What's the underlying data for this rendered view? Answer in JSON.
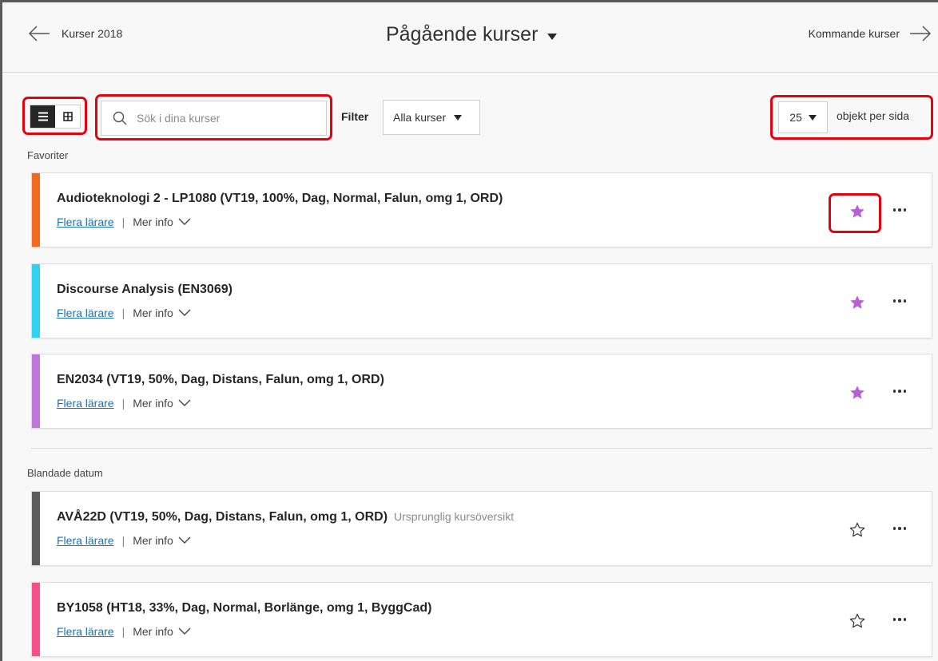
{
  "header": {
    "prev_label": "Kurser 2018",
    "title": "Pågående kurser",
    "next_label": "Kommande kurser"
  },
  "toolbar": {
    "search_placeholder": "Sök i dina kurser",
    "filter_label": "Filter",
    "filter_value": "Alla kurser",
    "per_page_value": "25",
    "per_page_label": "objekt per sida"
  },
  "sections": {
    "favorites": "Favoriter",
    "mixed": "Blandade datum"
  },
  "courses": [
    {
      "name": "Audioteknologi 2 - LP1080 (VT19, 100%, Dag, Normal, Falun, omg 1, ORD)",
      "subtitle": "",
      "teachers": "Flera lärare",
      "more": "Mer info",
      "accent": "#f26b1d",
      "favorite": true
    },
    {
      "name": "Discourse Analysis (EN3069)",
      "subtitle": "",
      "teachers": "Flera lärare",
      "more": "Mer info",
      "accent": "#2fd2f5",
      "favorite": true
    },
    {
      "name": "EN2034 (VT19, 50%, Dag, Distans, Falun, omg 1, ORD)",
      "subtitle": "",
      "teachers": "Flera lärare",
      "more": "Mer info",
      "accent": "#c077dd",
      "favorite": true
    },
    {
      "name": "AVÅ22D (VT19, 50%, Dag, Distans, Falun, omg 1, ORD)",
      "subtitle": "Ursprunglig kursöversikt",
      "teachers": "Flera lärare",
      "more": "Mer info",
      "accent": "#5c5c5c",
      "favorite": false
    },
    {
      "name": "BY1058 (HT18, 33%, Dag, Normal, Borlänge, omg 1, ByggCad)",
      "subtitle": "",
      "teachers": "Flera lärare",
      "more": "Mer info",
      "accent": "#f5508a",
      "favorite": false
    }
  ],
  "colors": {
    "favorite_star": "#b65fd7",
    "highlight": "#e8000b",
    "link": "#1b72b8"
  },
  "icons": {
    "prev": "arrow-left-icon",
    "next": "arrow-right-icon",
    "list_view": "list-view-icon",
    "grid_view": "grid-view-icon",
    "search": "search-icon",
    "favorite_on": "star-filled-icon",
    "favorite_off": "star-outline-icon",
    "more_options": "more-options-icon"
  }
}
